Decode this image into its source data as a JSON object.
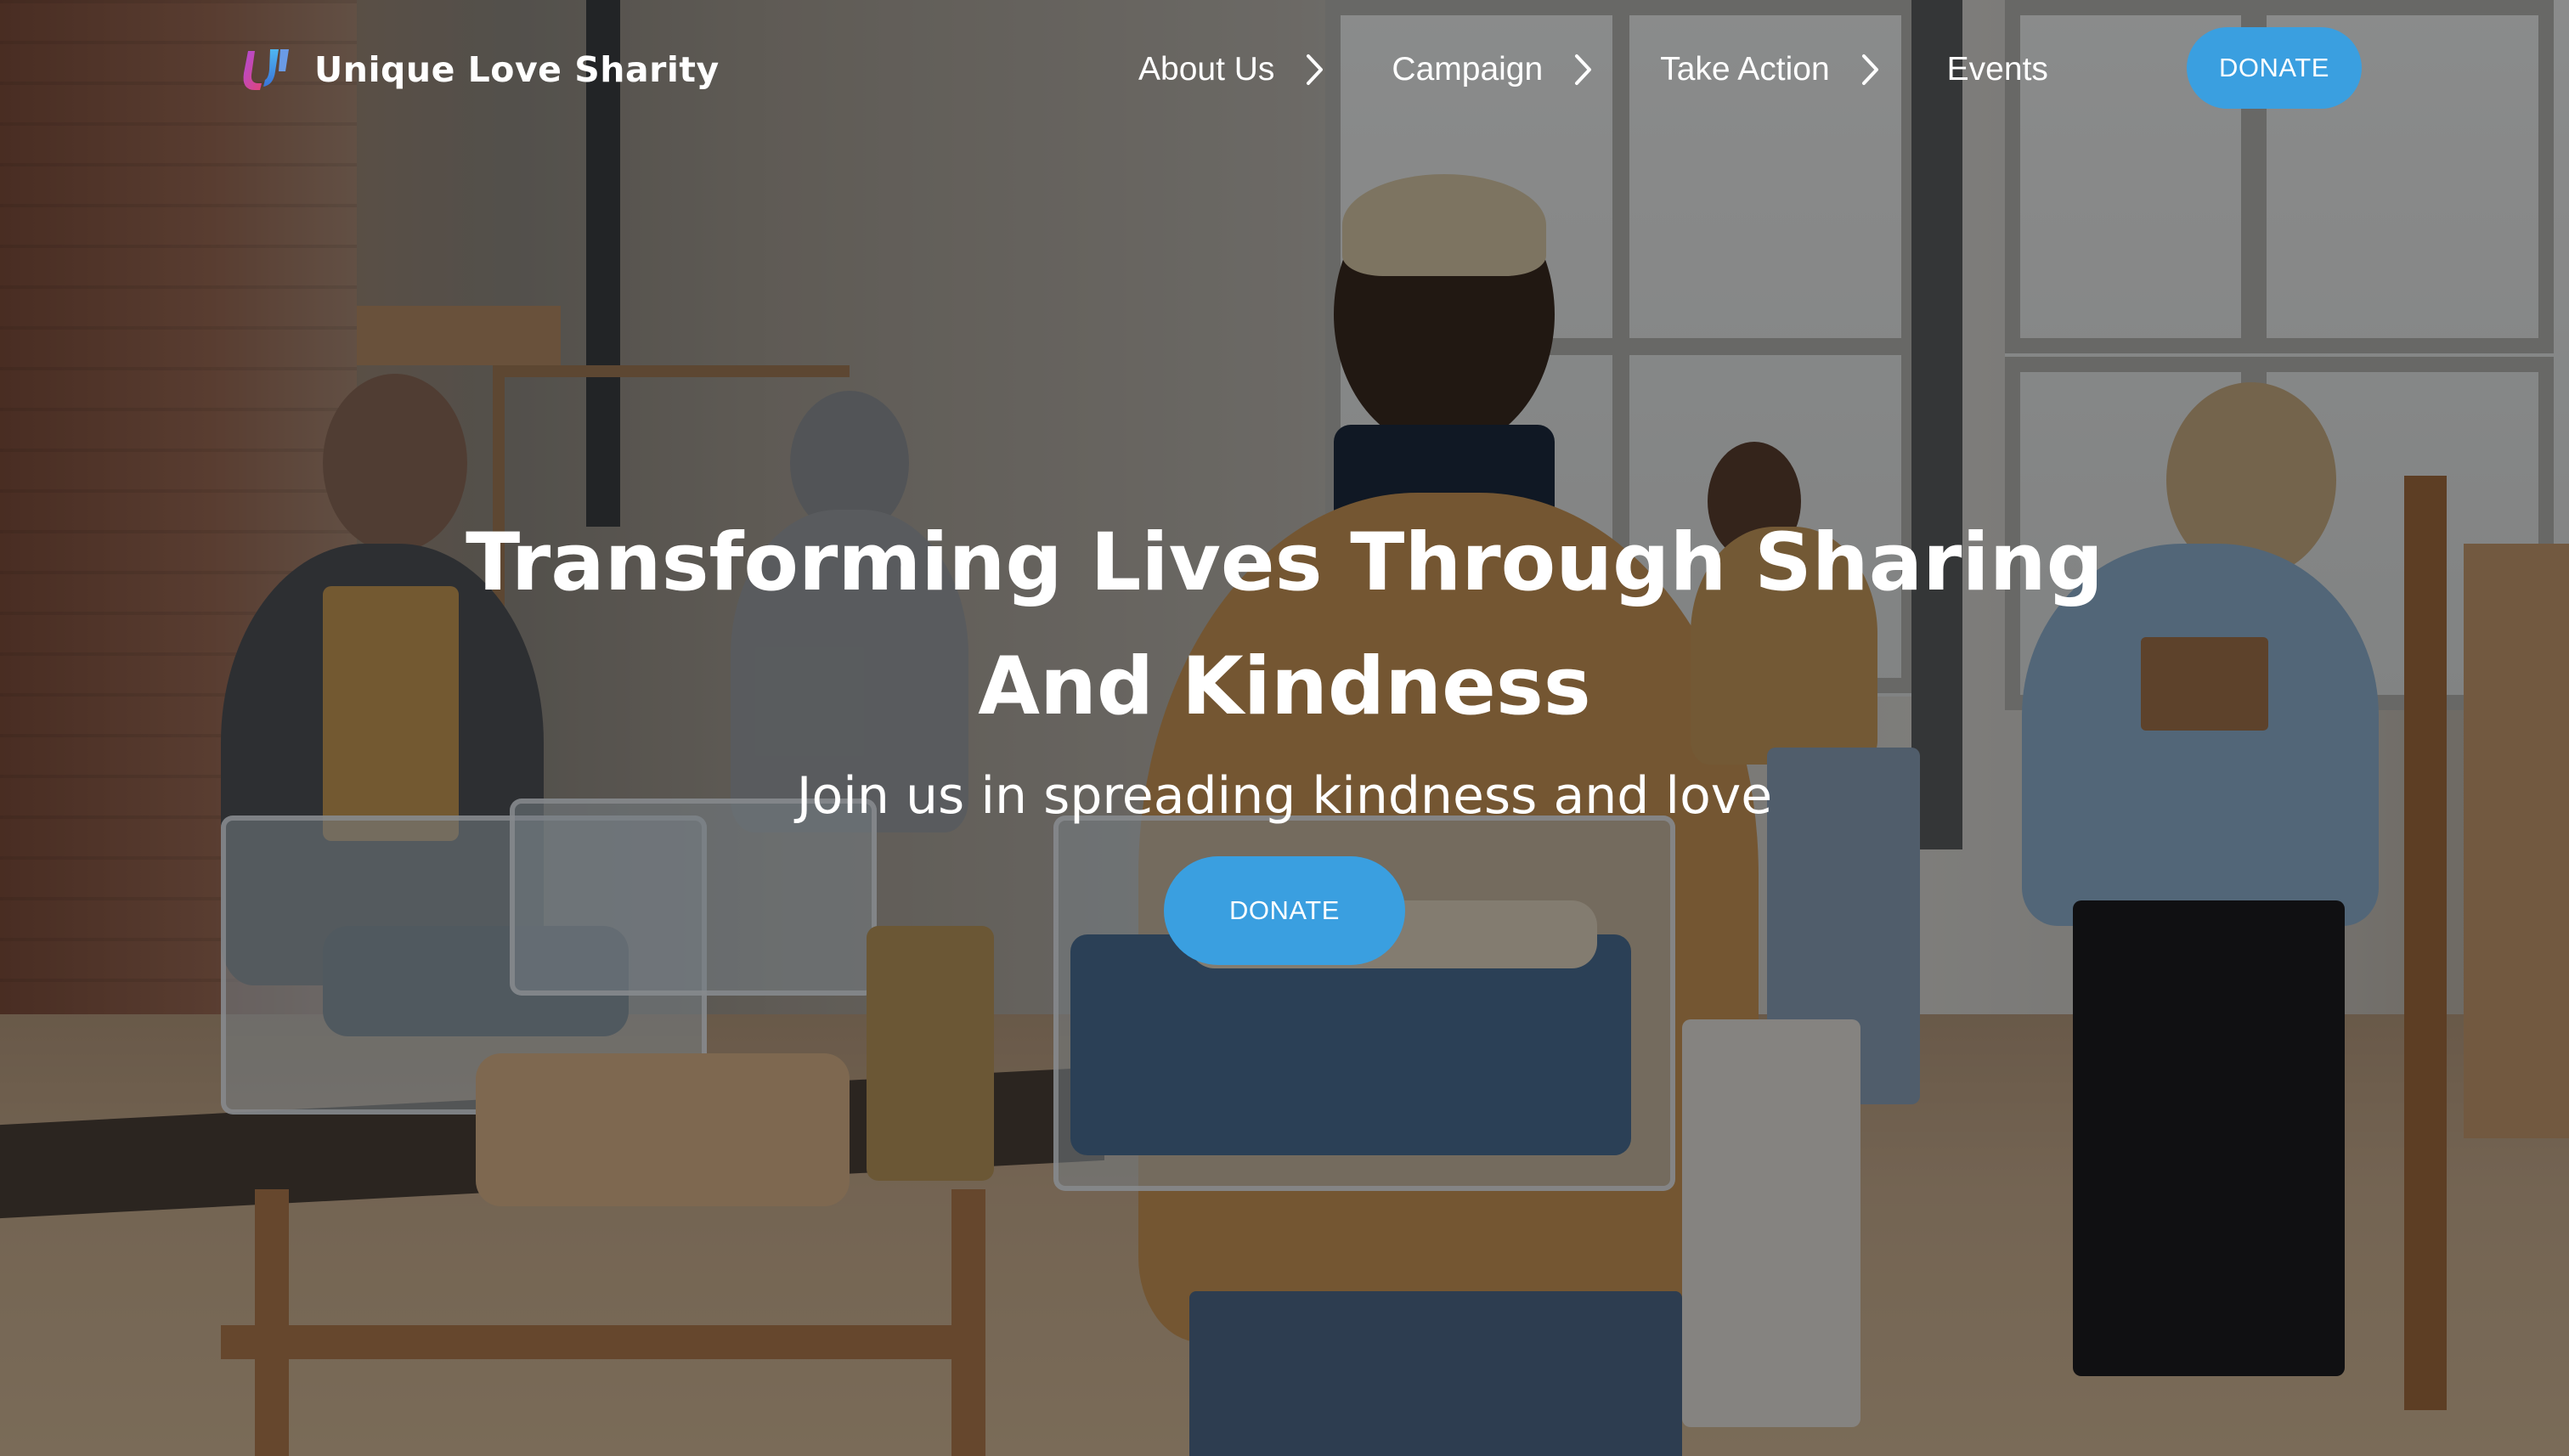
{
  "brand": {
    "name": "Unique Love Sharity",
    "logo_icon": "ul-logo-icon"
  },
  "nav": {
    "items": [
      {
        "label": "About Us",
        "has_submenu": true
      },
      {
        "label": "Campaign",
        "has_submenu": true
      },
      {
        "label": "Take Action",
        "has_submenu": true
      },
      {
        "label": "Events",
        "has_submenu": false
      }
    ],
    "donate_label": "DONATE"
  },
  "hero": {
    "headline": "Transforming Lives Through Sharing And Kindness",
    "subheadline": "Join us in spreading kindness and love",
    "donate_label": "DONATE"
  },
  "colors": {
    "accent": "#3a9fe0",
    "text": "#ffffff",
    "overlay": "rgba(0,0,0,0.42)"
  }
}
